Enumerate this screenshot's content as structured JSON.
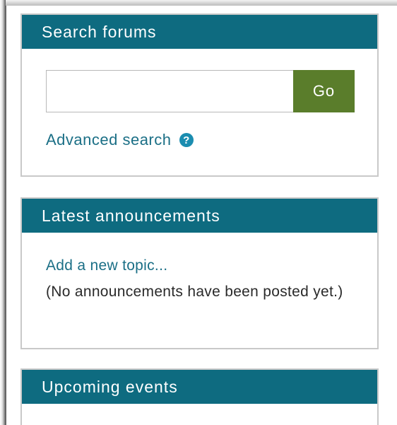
{
  "search_block": {
    "title": "Search forums",
    "input_value": "",
    "go_label": "Go",
    "advanced_link": "Advanced search",
    "help_icon": "question-circle-icon"
  },
  "announcements_block": {
    "title": "Latest announcements",
    "add_topic_link": "Add a new topic...",
    "empty_message": "(No announcements have been posted yet.)"
  },
  "events_block": {
    "title": "Upcoming events"
  },
  "colors": {
    "header_bg": "#0e6b80",
    "link": "#1b6f86",
    "go_button": "#5a7d2b"
  }
}
